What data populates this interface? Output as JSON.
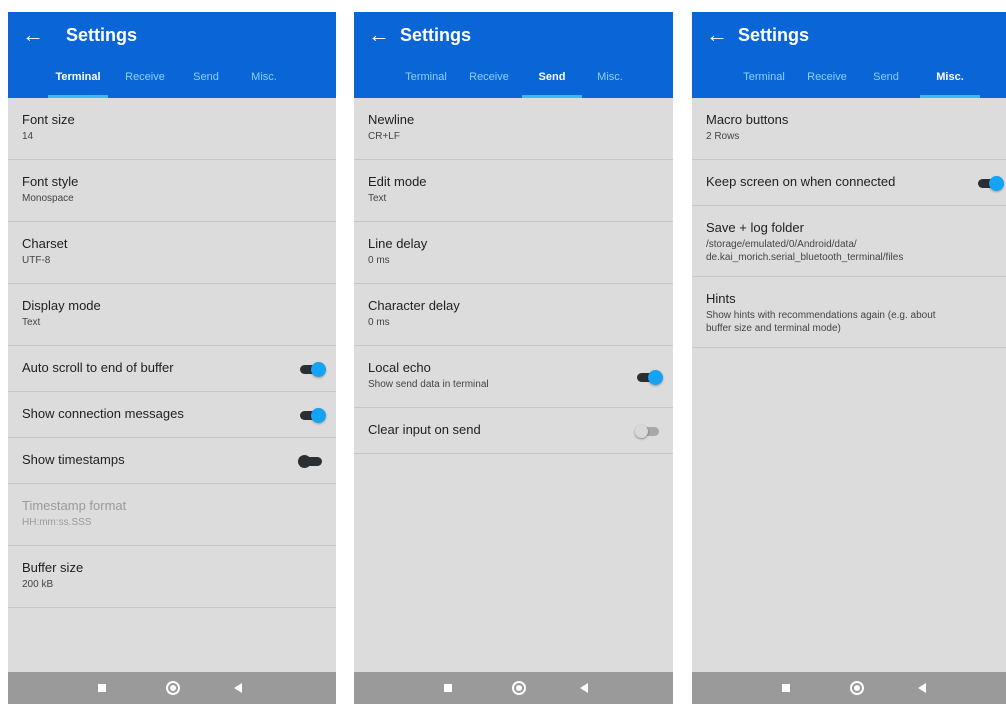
{
  "colors": {
    "appbar": "#0a66d6",
    "accent": "#3bb9ff",
    "list_bg": "#dcdcdc",
    "toggle_on": "#14a3f5",
    "navbar": "#9a9a9a"
  },
  "screens": [
    {
      "title": "Settings",
      "tabs": [
        "Terminal",
        "Receive",
        "Send",
        "Misc."
      ],
      "active_tab": "Terminal",
      "items": [
        {
          "title": "Font size",
          "summary": "14"
        },
        {
          "title": "Font style",
          "summary": "Monospace"
        },
        {
          "title": "Charset",
          "summary": "UTF-8"
        },
        {
          "title": "Display mode",
          "summary": "Text"
        },
        {
          "title": "Auto scroll to end of buffer",
          "switch": "on"
        },
        {
          "title": "Show connection messages",
          "switch": "on"
        },
        {
          "title": "Show timestamps",
          "switch": "off"
        },
        {
          "title": "Timestamp format",
          "summary": "HH:mm:ss.SSS",
          "enabled": false
        },
        {
          "title": "Buffer size",
          "summary": "200 kB"
        }
      ]
    },
    {
      "title": "Settings",
      "tabs": [
        "Terminal",
        "Receive",
        "Send",
        "Misc."
      ],
      "active_tab": "Send",
      "items": [
        {
          "title": "Newline",
          "summary": "CR+LF"
        },
        {
          "title": "Edit mode",
          "summary": "Text"
        },
        {
          "title": "Line delay",
          "summary": "0 ms"
        },
        {
          "title": "Character delay",
          "summary": "0 ms"
        },
        {
          "title": "Local echo",
          "summary": "Show send data in terminal",
          "switch": "on"
        },
        {
          "title": "Clear input on send",
          "switch": "off"
        }
      ]
    },
    {
      "title": "Settings",
      "tabs": [
        "Terminal",
        "Receive",
        "Send",
        "Misc."
      ],
      "active_tab": "Misc.",
      "items": [
        {
          "title": "Macro buttons",
          "summary": "2 Rows"
        },
        {
          "title": "Keep screen on when connected",
          "switch": "on"
        },
        {
          "title": "Save + log folder",
          "summary_lines": [
            "/storage/emulated/0/Android/data/",
            "de.kai_morich.serial_bluetooth_terminal/files"
          ]
        },
        {
          "title": "Hints",
          "summary_lines": [
            "Show hints with recommendations again (e.g. about",
            "buffer size and terminal mode)"
          ]
        }
      ]
    }
  ],
  "icons": {
    "back": "arrow-left-icon",
    "nav_recent": "square-icon",
    "nav_home": "circle-icon",
    "nav_back": "triangle-back-icon"
  }
}
